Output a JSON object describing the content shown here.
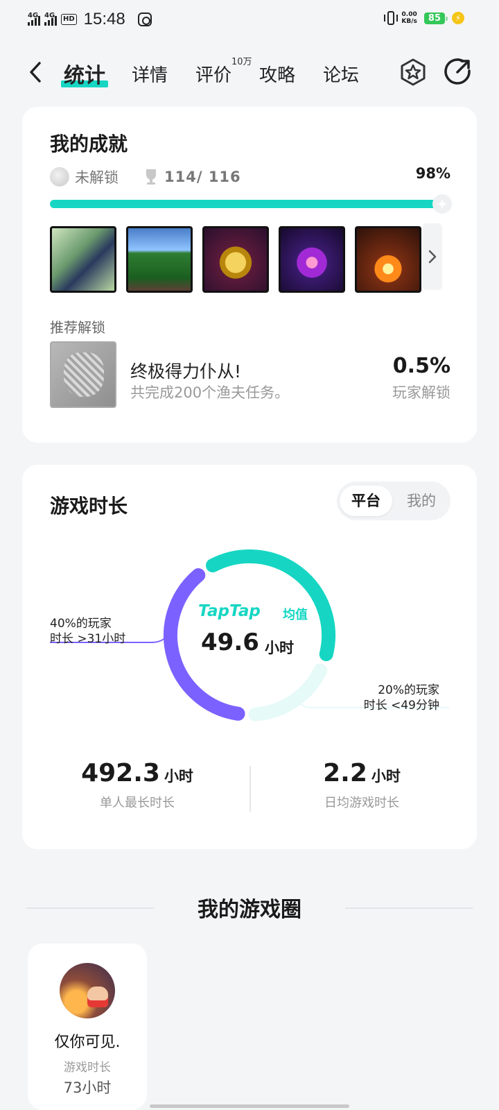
{
  "status_bar": {
    "net1": "4G",
    "net2": "4G",
    "hd": "HD",
    "time": "15:48",
    "speed_value": "0.00",
    "speed_unit": "KB/s",
    "battery": "85"
  },
  "nav": {
    "tabs": [
      {
        "label": "统计",
        "active": true
      },
      {
        "label": "详情"
      },
      {
        "label": "评价",
        "badge": "10万"
      },
      {
        "label": "攻略"
      },
      {
        "label": "论坛"
      }
    ],
    "icons": [
      "back-icon",
      "star-hex-icon",
      "share-icon"
    ]
  },
  "achievements": {
    "title": "我的成就",
    "locked_label": "未解锁",
    "count": "114/ 116",
    "percent_text": "98%",
    "progress": 0.98,
    "badges": [
      "achievement-icon-1",
      "achievement-icon-2",
      "achievement-icon-3",
      "achievement-icon-4",
      "achievement-icon-5"
    ],
    "recommend": {
      "label": "推荐解锁",
      "name": "终极得力仆从!",
      "desc": "共完成200个渔夫任务。",
      "percent": "0.5%",
      "percent_label": "玩家解锁"
    }
  },
  "playtime": {
    "title": "游戏时长",
    "toggle": [
      "平台",
      "我的"
    ],
    "selected_toggle": "平台",
    "brand": "TapTap",
    "brand_sub": "均值",
    "avg_value": "49.6",
    "avg_unit": "小时",
    "left_label_1": "40%的玩家",
    "left_label_2": "时长  >31小时",
    "right_label_1": "20%的玩家",
    "right_label_2": "时长  <49分钟",
    "segments": [
      {
        "share": 0.4,
        "color": "#7b61ff"
      },
      {
        "share": 0.4,
        "color": "#16d6c3"
      },
      {
        "share": 0.2,
        "color": "#e6faf8"
      }
    ],
    "stats": [
      {
        "value": "492.3",
        "unit": "小时",
        "label": "单人最长时长"
      },
      {
        "value": "2.2",
        "unit": "小时",
        "label": "日均游戏时长"
      }
    ]
  },
  "circle": {
    "title": "我的游戏圈",
    "friends": [
      {
        "name": "仅你可见.",
        "label": "游戏时长",
        "value": "73小时"
      }
    ]
  },
  "colors": {
    "accent": "#16d6c3",
    "purple": "#7b61ff"
  }
}
